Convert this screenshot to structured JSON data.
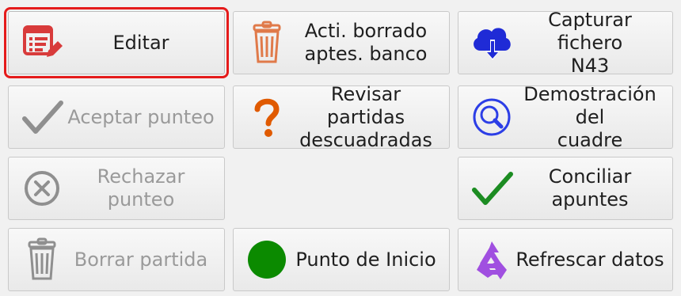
{
  "buttons": {
    "editar": {
      "label": "Editar"
    },
    "acti_borrado": {
      "label": "Acti. borrado\naptes. banco"
    },
    "capturar": {
      "label": "Capturar fichero\nN43"
    },
    "aceptar_punteo": {
      "label": "Aceptar punteo"
    },
    "revisar_partidas": {
      "label": "Revisar partidas\ndescuadradas"
    },
    "demostracion": {
      "label": "Demostración del\ncuadre"
    },
    "rechazar_punteo": {
      "label": "Rechazar punteo"
    },
    "conciliar": {
      "label": "Conciliar apuntes"
    },
    "borrar_partida": {
      "label": "Borrar partida"
    },
    "punto_inicio": {
      "label": "Punto de Inicio"
    },
    "refrescar": {
      "label": "Refrescar datos"
    }
  },
  "icons": {
    "editar": "edit-list-icon",
    "acti_borrado": "trash-icon",
    "capturar": "cloud-download-icon",
    "aceptar_punteo": "check-icon",
    "revisar_partidas": "question-icon",
    "demostracion": "magnifier-icon",
    "rechazar_punteo": "cancel-circle-icon",
    "conciliar": "check-icon",
    "borrar_partida": "trash-icon",
    "punto_inicio": "green-circle-icon",
    "refrescar": "recycle-icon"
  },
  "colors": {
    "selected_outline": "#e51b1b",
    "edit_icon": "#d83b3b",
    "trash_orange": "#e07a4a",
    "cloud_blue": "#1f2bd6",
    "question_orange": "#e05a00",
    "magnifier_blue": "#2c3ee6",
    "check_green": "#1c8c22",
    "circle_green": "#0b8a00",
    "recycle_purple": "#a04fe0",
    "disabled_gray": "#9a9a9a"
  }
}
